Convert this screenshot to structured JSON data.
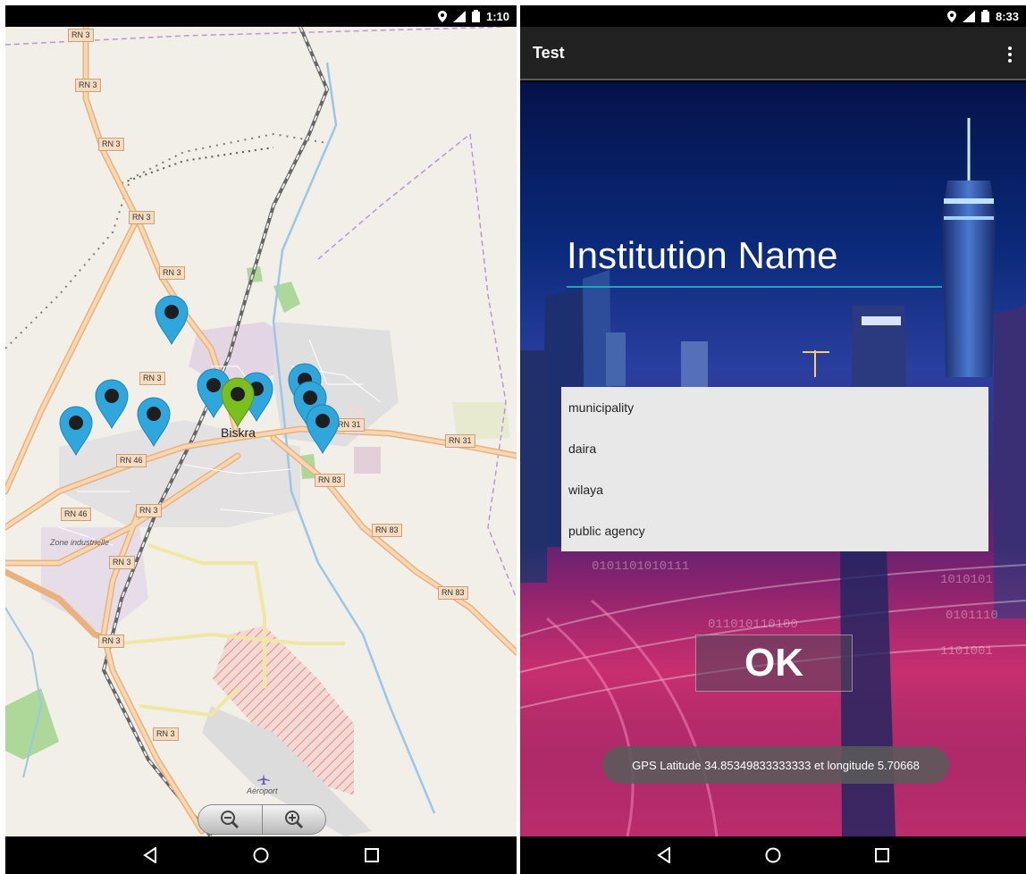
{
  "left_screen": {
    "status_bar": {
      "time": "1:10"
    },
    "map": {
      "city_name": "Biskra",
      "road_labels": [
        "RN 3",
        "RN 3",
        "RN 3",
        "RN 3",
        "RN 3",
        "RN 3",
        "RN 3",
        "RN 3",
        "RN 3",
        "RN 31",
        "RN 31",
        "RN 46",
        "RN 46",
        "RN 83",
        "RN 83",
        "RN 83"
      ],
      "area_labels": {
        "industrial_zone": "Zone industrielle",
        "airport": "Aéroport"
      },
      "marker_colors": {
        "default": "#2fa7dc",
        "selected": "#7bbf1f"
      }
    }
  },
  "right_screen": {
    "status_bar": {
      "time": "8:33"
    },
    "app_bar": {
      "title": "Test"
    },
    "institution_field": {
      "placeholder": "Institution Name",
      "value": ""
    },
    "dropdown": {
      "items": [
        "municipality",
        "daira",
        "wilaya",
        "public agency"
      ]
    },
    "ok_button": {
      "label": "OK"
    },
    "toast": {
      "text": "GPS Latitude 34.85349833333333 et longitude 5.70668"
    },
    "accent_color": "#16a9b9"
  },
  "icons": [
    "location-icon",
    "signal-icon",
    "battery-icon",
    "back-icon",
    "home-icon",
    "recents-icon",
    "zoom-out-icon",
    "zoom-in-icon",
    "overflow-menu-icon",
    "map-marker-icon"
  ]
}
